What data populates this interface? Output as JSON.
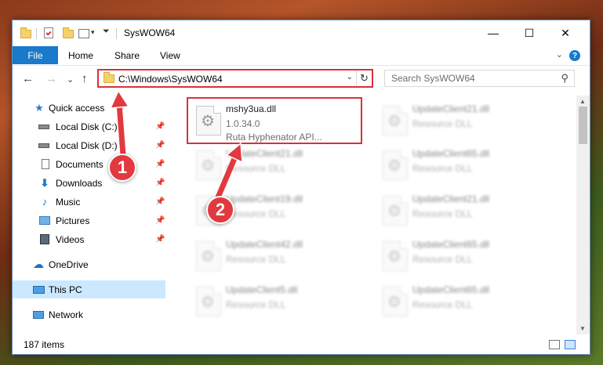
{
  "window": {
    "title": "SysWOW64"
  },
  "titlebar": {
    "minimize_glyph": "—",
    "maximize_glyph": "☐",
    "close_glyph": "✕"
  },
  "ribbon": {
    "tabs": [
      "File",
      "Home",
      "Share",
      "View"
    ],
    "help_glyph": "?"
  },
  "navigation": {
    "back_glyph": "←",
    "forward_glyph": "→",
    "recent_glyph": "⌄",
    "up_glyph": "↑",
    "address": "C:\\Windows\\SysWOW64",
    "refresh_glyph": "↻",
    "search_placeholder": "Search SysWOW64"
  },
  "sidebar": {
    "items": [
      {
        "label": "Quick access",
        "icon": "star-icon",
        "pinned": false
      },
      {
        "label": "Local Disk (C:)",
        "icon": "drive-icon",
        "pinned": true
      },
      {
        "label": "Local Disk (D:)",
        "icon": "drive-icon",
        "pinned": true
      },
      {
        "label": "Documents",
        "icon": "documents-icon",
        "pinned": true
      },
      {
        "label": "Downloads",
        "icon": "downloads-icon",
        "pinned": true
      },
      {
        "label": "Music",
        "icon": "music-icon",
        "pinned": true
      },
      {
        "label": "Pictures",
        "icon": "pictures-icon",
        "pinned": true
      },
      {
        "label": "Videos",
        "icon": "videos-icon",
        "pinned": true
      },
      {
        "label": "OneDrive",
        "icon": "cloud-icon",
        "pinned": false
      },
      {
        "label": "This PC",
        "icon": "computer-icon",
        "pinned": false,
        "selected": true
      },
      {
        "label": "Network",
        "icon": "network-icon",
        "pinned": false
      }
    ]
  },
  "files": {
    "highlighted": {
      "name": "mshy3ua.dll",
      "version": "1.0.34.0",
      "description": "Ruta Hyphenator API..."
    },
    "left_column": [
      {
        "name": "UpdateClient21.dll",
        "type": "Resource DLL"
      },
      {
        "name": "UpdateClient19.dll",
        "type": "Resource DLL"
      },
      {
        "name": "UpdateClient42.dll",
        "type": "Resource DLL"
      },
      {
        "name": "UpdateClient5.dll",
        "type": "Resource DLL"
      }
    ],
    "right_column": [
      {
        "name": "UpdateClient21.dll",
        "type": "Resource DLL"
      },
      {
        "name": "UpdateClient65.dll",
        "type": "Resource DLL"
      },
      {
        "name": "UpdateClient21.dll",
        "type": "Resource DLL"
      },
      {
        "name": "UpdateClient65.dll",
        "type": "Resource DLL"
      },
      {
        "name": "UpdateClient65.dll",
        "type": "Resource DLL"
      }
    ]
  },
  "status": {
    "item_count": "187 items"
  },
  "callouts": [
    "1",
    "2"
  ],
  "colors": {
    "accent": "#1979ca",
    "highlight_red": "#d8313a",
    "selected": "#cce8ff"
  }
}
